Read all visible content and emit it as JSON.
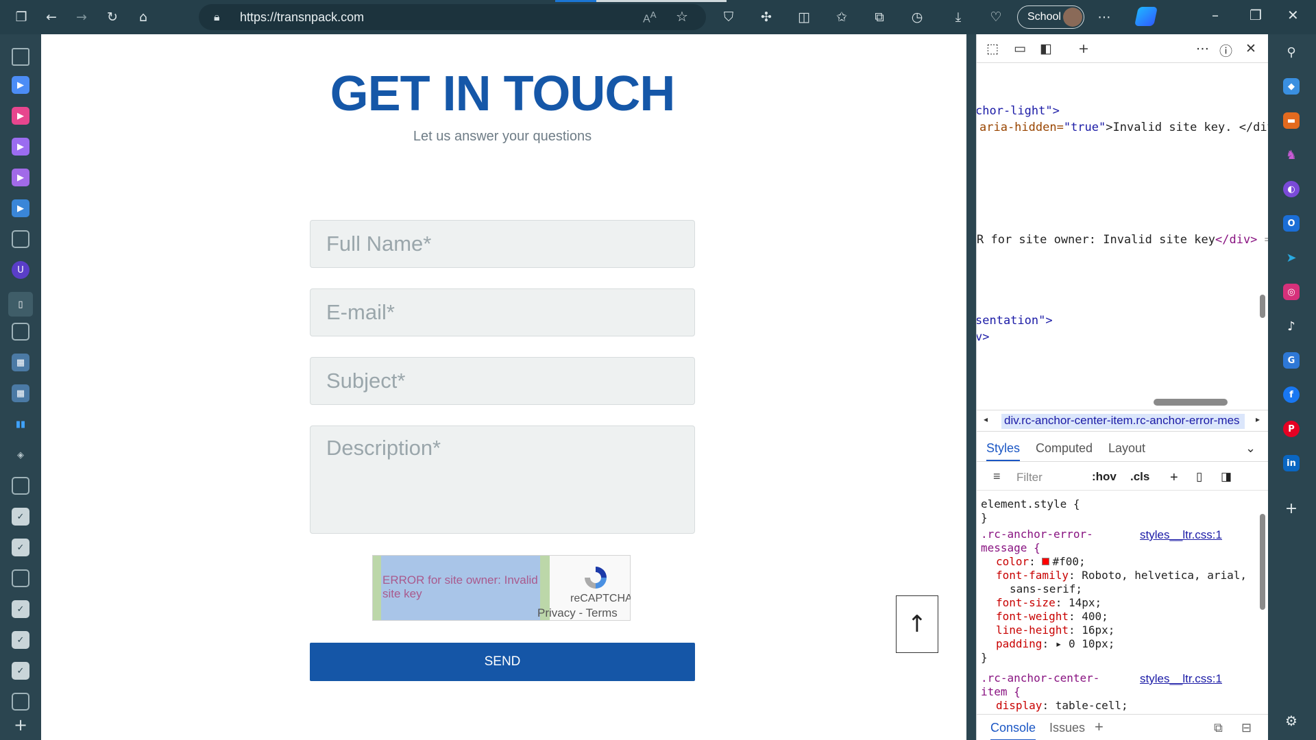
{
  "browser": {
    "url": "https://transnpack.com",
    "read_aloud_label": "Á)",
    "profile_label": "School",
    "icons": [
      "tab-actions-icon",
      "back-icon",
      "forward-icon",
      "refresh-icon",
      "home-icon",
      "lock-icon",
      "read-aloud-icon",
      "favorite-star-icon",
      "shield-icon",
      "extensions-icon",
      "split-screen-icon",
      "favorites-icon",
      "collections-icon",
      "history-icon",
      "downloads-icon",
      "browser-essentials-icon",
      "more-icon",
      "copilot-icon",
      "minimize-icon",
      "maximize-icon",
      "close-icon"
    ]
  },
  "page": {
    "title": "GET IN TOUCH",
    "subtitle": "Let us answer your questions",
    "form": {
      "full_name_placeholder": "Full Name*",
      "email_placeholder": "E-mail*",
      "subject_placeholder": "Subject*",
      "description_placeholder": "Description*",
      "captcha_error_line1": "ERROR for site owner: Invalid",
      "captcha_error_line2": "site key",
      "captcha_brand": "reCAPTCHA",
      "captcha_terms": "Privacy - Terms",
      "send_label": "SEND"
    },
    "scroll_to_top_icon": "arrow-up-icon"
  },
  "devtools": {
    "html_lines": {
      "line1": "chor-light\">",
      "line2_attr": "aria-hidden=",
      "line2_val": "\"true\"",
      "line2_text": ">Invalid site key. </div",
      "line3_text": "R for site owner: Invalid site key",
      "line3_tag": "</div>",
      "line3_eq": "=",
      "line4": "sentation\">",
      "line5": "v>"
    },
    "breadcrumb": "div.rc-anchor-center-item.rc-anchor-error-mes",
    "tabs": [
      "Styles",
      "Computed",
      "Layout"
    ],
    "active_tab": "Styles",
    "filter_placeholder": "Filter",
    "hov": ":hov",
    "cls": ".cls",
    "styles": {
      "element_style": "element.style {",
      "close_brace": "}",
      "rule1_selector_a": ".rc-anchor-error-",
      "rule1_selector_b": "message {",
      "rule1_source": "styles__ltr.css:1",
      "props": [
        {
          "name": "color",
          "value": "#f00;"
        },
        {
          "name": "font-family",
          "value": "Roboto, helvetica, arial,"
        },
        {
          "name": "",
          "value": "sans-serif;"
        },
        {
          "name": "font-size",
          "value": "14px;"
        },
        {
          "name": "font-weight",
          "value": "400;"
        },
        {
          "name": "line-height",
          "value": "16px;"
        },
        {
          "name": "padding",
          "value": "▸ 0 10px;"
        }
      ],
      "rule2_selector_a": ".rc-anchor-center-",
      "rule2_selector_b": "item {",
      "rule2_source": "styles__ltr.css:1",
      "rule2_prop": "display",
      "rule2_value": "table-cell;",
      "swatch_color": "#ff0000"
    },
    "drawer_tabs": [
      "Console",
      "Issues"
    ]
  },
  "colors": {
    "brand_blue": "#1557a8",
    "chrome_dark": "#253f4a",
    "sidebar": "#2b4550"
  }
}
